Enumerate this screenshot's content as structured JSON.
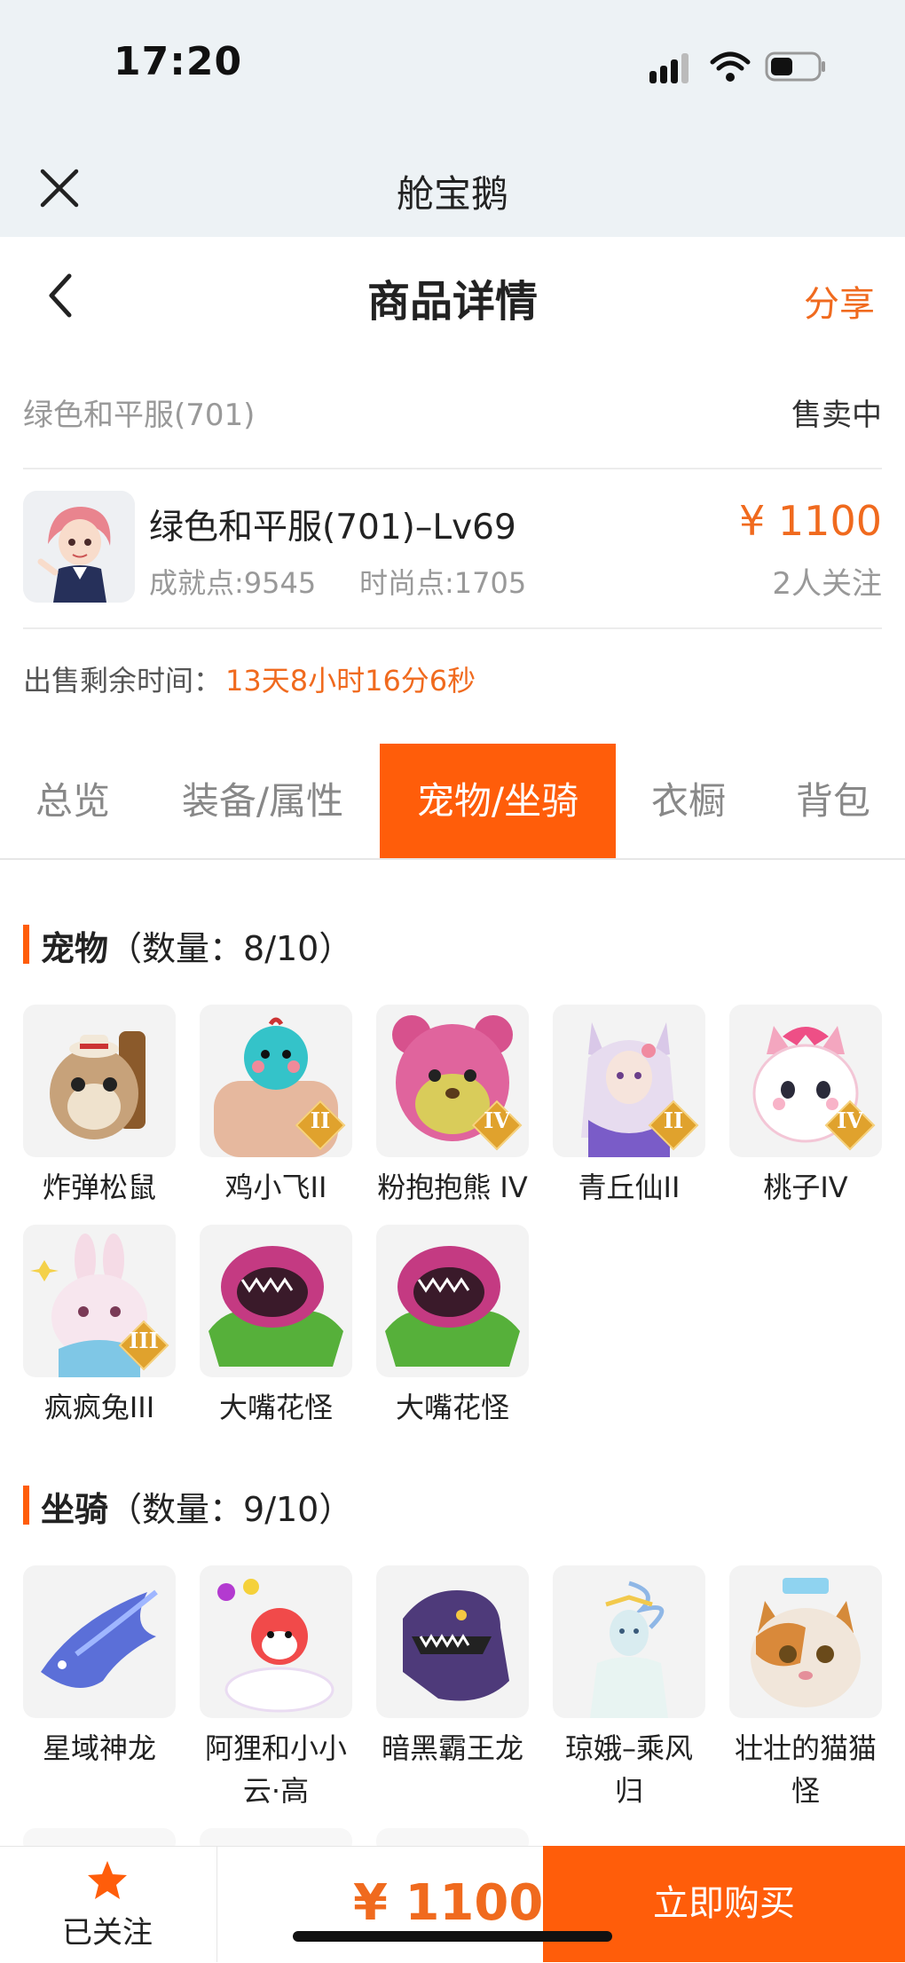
{
  "status_bar": {
    "time": "17:20"
  },
  "mini_program": {
    "title": "舱宝鹅"
  },
  "nav": {
    "title": "商品详情",
    "share": "分享"
  },
  "product": {
    "server": "绿色和平服(701)",
    "status": "售卖中",
    "title": "绿色和平服(701)–Lv69",
    "achievement": "成就点:9545",
    "fashion": "时尚点:1705",
    "price": "¥ 1100",
    "followers": "2人关注",
    "remaining_label": "出售剩余时间：",
    "remaining_value": "13天8小时16分6秒"
  },
  "tabs": [
    {
      "label": "总览",
      "active": false
    },
    {
      "label": "装备/属性",
      "active": false
    },
    {
      "label": "宠物/坐骑",
      "active": true
    },
    {
      "label": "衣橱",
      "active": false
    },
    {
      "label": "背包",
      "active": false
    }
  ],
  "pets": {
    "title": "宠物",
    "count": "（数量：8/10）",
    "items": [
      {
        "name": "炸弹松鼠",
        "rank": ""
      },
      {
        "name": "鸡小飞II",
        "rank": "II"
      },
      {
        "name": "粉抱抱熊 IV",
        "rank": "IV"
      },
      {
        "name": "青丘仙II",
        "rank": "II"
      },
      {
        "name": "桃子IV",
        "rank": "IV"
      },
      {
        "name": "疯疯兔III",
        "rank": "III"
      },
      {
        "name": "大嘴花怪",
        "rank": ""
      },
      {
        "name": "大嘴花怪",
        "rank": ""
      }
    ]
  },
  "mounts": {
    "title": "坐骑",
    "count": "（数量：9/10）",
    "items": [
      {
        "name": "星域神龙"
      },
      {
        "name": "阿狸和小小云·高"
      },
      {
        "name": "暗黑霸王龙"
      },
      {
        "name": "琼娥–乘风归"
      },
      {
        "name": "壮壮的猫猫怪"
      }
    ]
  },
  "bottom_bar": {
    "follow_label": "已关注",
    "price": "¥ 1100",
    "buy_label": "立即购买"
  },
  "colors": {
    "accent": "#ff5d0a",
    "price": "#f06a1e",
    "header_bg": "#edf2f5"
  }
}
